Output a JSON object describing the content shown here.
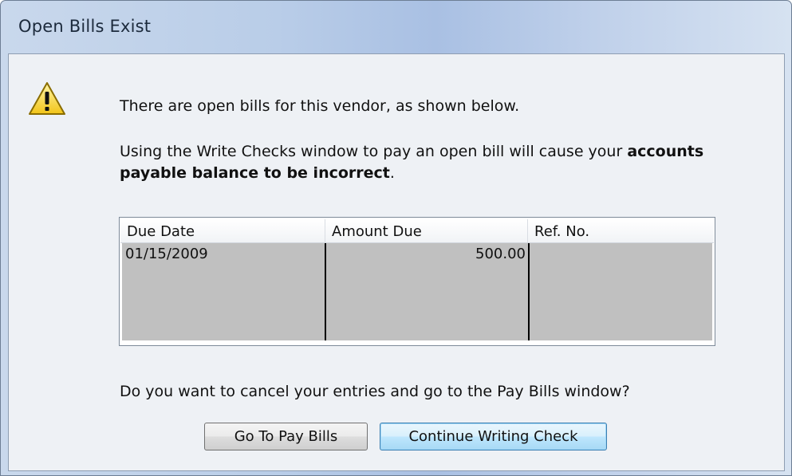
{
  "window": {
    "title": "Open Bills Exist"
  },
  "icons": {
    "warning": "warning-triangle-icon"
  },
  "messages": {
    "line1": "There are open bills for this vendor, as shown below.",
    "line2_prefix": "Using the Write Checks window to pay an open bill will cause your ",
    "line2_bold": "accounts payable balance to be incorrect",
    "line2_suffix": ".",
    "question": "Do you want to cancel your entries and go to the Pay Bills window?"
  },
  "bills_table": {
    "columns": [
      "Due Date",
      "Amount Due",
      "Ref. No."
    ],
    "rows": [
      {
        "due_date": "01/15/2009",
        "amount_due": "500.00",
        "ref_no": ""
      }
    ]
  },
  "buttons": {
    "go_to_pay_bills": "Go To Pay Bills",
    "continue_writing_check": "Continue Writing Check"
  },
  "colors": {
    "accent_button_border": "#3c7fb1",
    "grid_body": "#c0c0c0",
    "dialog_background": "#eef1f5"
  }
}
